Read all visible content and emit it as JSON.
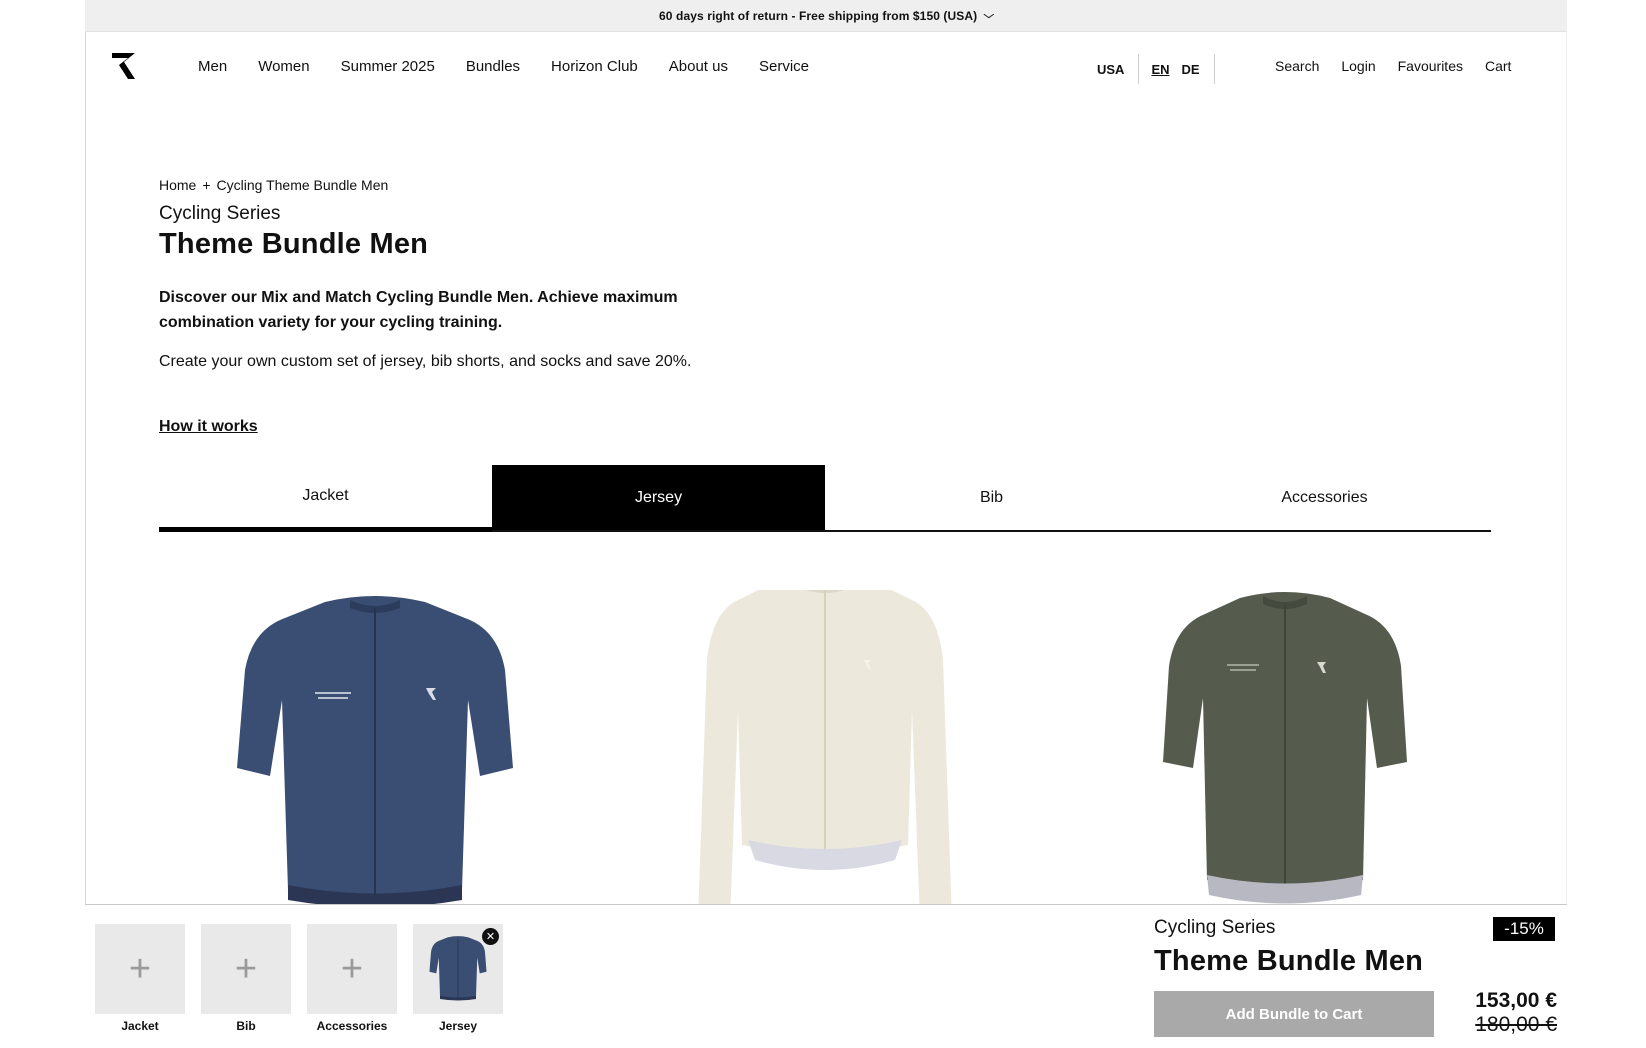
{
  "announcement": {
    "text": "60 days right of return - Free shipping from $150 (USA)"
  },
  "nav": [
    "Men",
    "Women",
    "Summer 2025",
    "Bundles",
    "Horizon Club",
    "About us",
    "Service"
  ],
  "locale": {
    "country": "USA",
    "lang_en": "EN",
    "lang_de": "DE"
  },
  "utility": {
    "search": "Search",
    "login": "Login",
    "favourites": "Favourites",
    "cart": "Cart"
  },
  "breadcrumb": {
    "home": "Home",
    "separator": "+",
    "current": "Cycling Theme Bundle Men"
  },
  "product": {
    "series": "Cycling Series",
    "title": "Theme Bundle Men",
    "lead": "Discover our Mix and Match Cycling Bundle Men. Achieve maximum combination variety for your cycling training.",
    "description": "Create your own custom set of jersey, bib shorts, and socks and save 20%.",
    "how_it_works": "How it works"
  },
  "tabs": [
    "Jacket",
    "Jersey",
    "Bib",
    "Accessories"
  ],
  "active_tab": "Jersey",
  "products": [
    {
      "name": "navy-short-sleeve-jersey",
      "color": "#3a4d72"
    },
    {
      "name": "cream-long-sleeve-jersey",
      "color": "#ece8dc"
    },
    {
      "name": "olive-short-sleeve-jersey",
      "color": "#555b4d"
    }
  ],
  "bundle_bar": {
    "slots": [
      "Jacket",
      "Bib",
      "Accessories",
      "Jersey"
    ],
    "series": "Cycling Series",
    "title": "Theme Bundle Men",
    "discount": "-15%",
    "add_button": "Add Bundle to Cart",
    "price": "153,00 €",
    "old_price": "180,00 €"
  }
}
